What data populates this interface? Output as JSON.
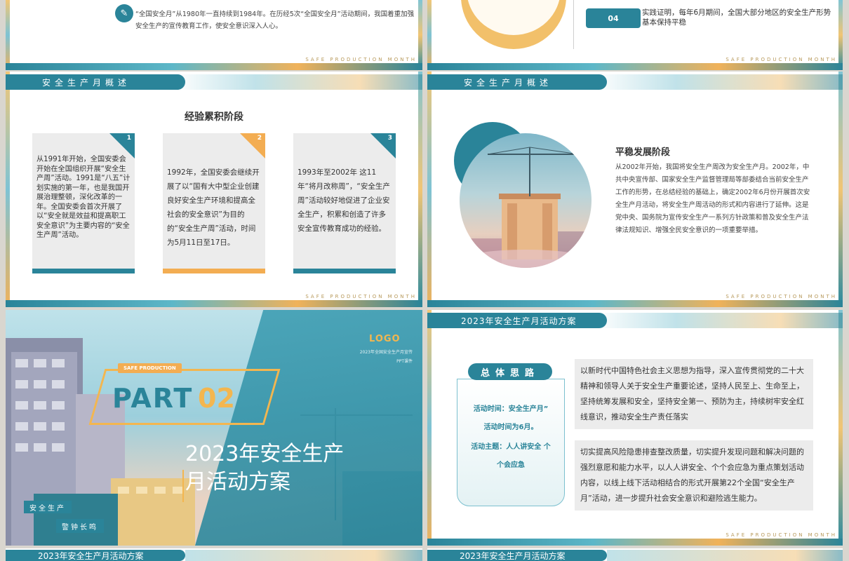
{
  "s1": {
    "text": "“全国安全月”从1980年一直持续到1984年。在历经5次“全国安全月”活动期间，我国着重加强安全生产的宣传教育工作，使安全意识深入人心。"
  },
  "s2": {
    "num": "04",
    "text": "实践证明，每年6月期间，全国大部分地区的安全生产形势基本保持平稳"
  },
  "footer_text": "SAFE PRODUCTION MONTH",
  "s3": {
    "header": "安全生产月概述",
    "title": "经验累积阶段",
    "cards": [
      {
        "num": "1",
        "text": "从1991年开始，全国安委会开始在全国组织开展“安全生产周”活动。1991是“八五”计划实施的第一年，也是我国开展治理整顿，深化改革的一年。全国安委会首次开展了以“安全就是效益和提高职工安全意识”为主要内容的“安全生产周”活动。"
      },
      {
        "num": "2",
        "text": "1992年，全国安委会继续开展了以“国有大中型企业创建良好安全生产环境和提高全社会的安全意识”为目的的“安全生产周”活动，时间为5月11日至17日。"
      },
      {
        "num": "3",
        "text": "1993年至2002年 这11年“将月改称周”，“安全生产周”活动较好地促进了企业安全生产，积累和创造了许多安全宣传教育成功的经验。"
      }
    ]
  },
  "s4": {
    "header": "安全生产月概述",
    "title": "平稳发展阶段",
    "text": "从2002年开始，我国将安全生产周改为安全生产月。2002年，中共中央宣传部、国家安全生产监督管理局等部委结合当前安全生产工作的形势，在总结经验的基础上，确定2002年6月份开展首次安全生产月活动，将安全生产周活动的形式和内容进行了延伸。这是党中央、国务院为宣传安全生产一系列方针政策和普及安全生产法律法规知识、增强全民安全意识的一项重要举措。"
  },
  "s5": {
    "logo": "LOGO",
    "logo_sub1": "2023年全国安全生产月宣传",
    "logo_sub2": "PPT课件",
    "tag": "SAFE PRODUCTION",
    "part": "PART",
    "part_num": "02",
    "title_line1": "2023年安全生产",
    "title_line2": "月活动方案",
    "label1": "安全生产",
    "label2": "警钟长鸣"
  },
  "s6": {
    "header": "2023年安全生产月活动方案",
    "pill": "总体思路",
    "left_lines": [
      "活动时间：安全生产月”",
      "活动时间为6月。",
      "活动主题：人人讲安全 个",
      "个会应急"
    ],
    "box1": "以新时代中国特色社会主义思想为指导，深入宣传贯彻党的二十大精神和领导人关于安全生产重要论述，坚持人民至上、生命至上，坚持统筹发展和安全，坚持安全第一、预防为主，持续树牢安全红线意识，推动安全生产责任落实",
    "box2": "切实提高风险隐患排查整改质量，切实提升发现问题和解决问题的强烈意愿和能力水平，以人人讲安全、个个会应急为重点策划活动内容，以线上线下活动相结合的形式开展第22个全国“安全生产月”活动，进一步提升社会安全意识和避险逃生能力。"
  },
  "strips": {
    "left": "2023年安全生产月活动方案",
    "right": "2023年安全生产月活动方案"
  },
  "colors": {
    "teal": "#2a8499",
    "gold": "#f3ad52"
  },
  "icons": {
    "pin": "tag-icon"
  }
}
